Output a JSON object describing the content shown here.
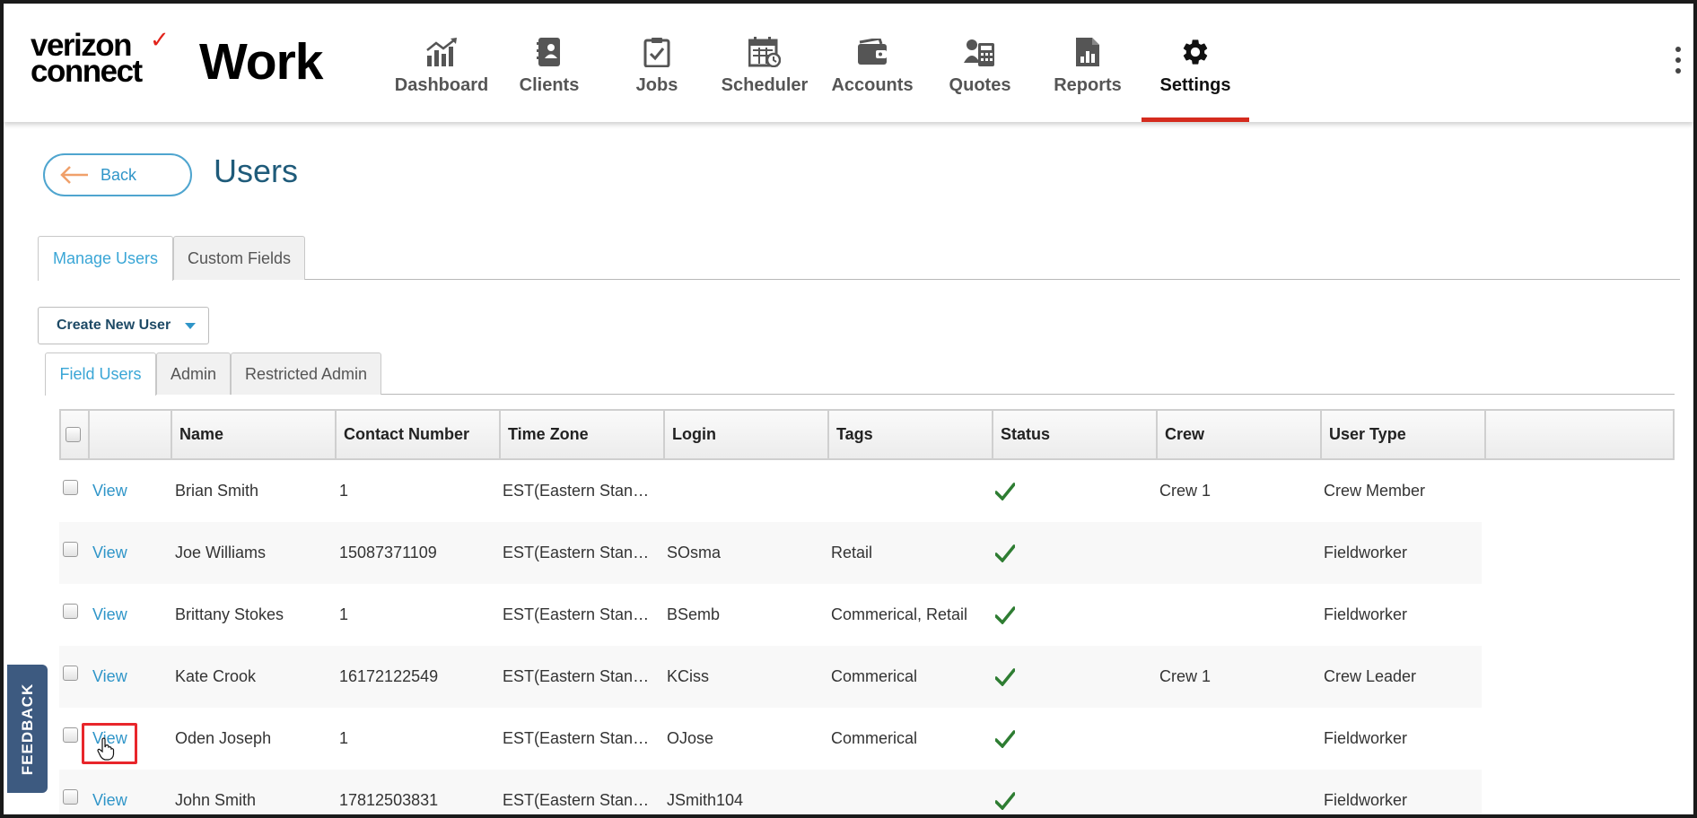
{
  "brand": {
    "logo_line1": "verizon",
    "logo_line2": "connect",
    "product": "Work",
    "accent": "#d52b1e"
  },
  "nav": [
    {
      "label": "Dashboard",
      "icon": "dashboard-chart-icon"
    },
    {
      "label": "Clients",
      "icon": "clients-book-icon"
    },
    {
      "label": "Jobs",
      "icon": "jobs-clipboard-icon"
    },
    {
      "label": "Scheduler",
      "icon": "scheduler-calendar-icon"
    },
    {
      "label": "Accounts",
      "icon": "accounts-wallet-icon"
    },
    {
      "label": "Quotes",
      "icon": "quotes-calculator-icon"
    },
    {
      "label": "Reports",
      "icon": "reports-document-icon"
    },
    {
      "label": "Settings",
      "icon": "gear-icon",
      "active": true
    }
  ],
  "page": {
    "back_label": "Back",
    "title": "Users"
  },
  "tabs": [
    "Manage Users",
    "Custom Fields"
  ],
  "create_button": "Create New User",
  "user_tabs": [
    "Field Users",
    "Admin",
    "Restricted Admin"
  ],
  "table": {
    "columns": [
      "Name",
      "Contact Number",
      "Time Zone",
      "Login",
      "Tags",
      "Status",
      "Crew",
      "User Type"
    ],
    "rows": [
      {
        "action": "View",
        "name": "Brian Smith",
        "contact": "1",
        "timezone": "EST(Eastern Stan…",
        "login": "",
        "tags": "",
        "status": "active",
        "crew": "Crew 1",
        "user_type": "Crew Member"
      },
      {
        "action": "View",
        "name": "Joe Williams",
        "contact": "15087371109",
        "timezone": "EST(Eastern Stan…",
        "login": "SOsma",
        "tags": "Retail",
        "status": "active",
        "crew": "",
        "user_type": "Fieldworker"
      },
      {
        "action": "View",
        "name": "Brittany Stokes",
        "contact": "1",
        "timezone": "EST(Eastern Stan…",
        "login": "BSemb",
        "tags": "Commerical, Retail",
        "status": "active",
        "crew": "",
        "user_type": "Fieldworker"
      },
      {
        "action": "View",
        "name": "Kate Crook",
        "contact": "16172122549",
        "timezone": "EST(Eastern Stan…",
        "login": "KCiss",
        "tags": "Commerical",
        "status": "active",
        "crew": "Crew 1",
        "user_type": "Crew Leader"
      },
      {
        "action": "View",
        "name": "Oden Joseph",
        "contact": "1",
        "timezone": "EST(Eastern Stan…",
        "login": "OJose",
        "tags": "Commerical",
        "status": "active",
        "crew": "",
        "user_type": "Fieldworker"
      },
      {
        "action": "View",
        "name": "John Smith",
        "contact": "17812503831",
        "timezone": "EST(Eastern Stan…",
        "login": "JSmith104",
        "tags": "",
        "status": "active",
        "crew": "",
        "user_type": "Fieldworker"
      }
    ]
  },
  "feedback_label": "FEEDBACK",
  "colors": {
    "link": "#2f95c8",
    "title": "#1f5b7a",
    "status_check": "#2e7d32",
    "highlight": "#e8262b"
  }
}
